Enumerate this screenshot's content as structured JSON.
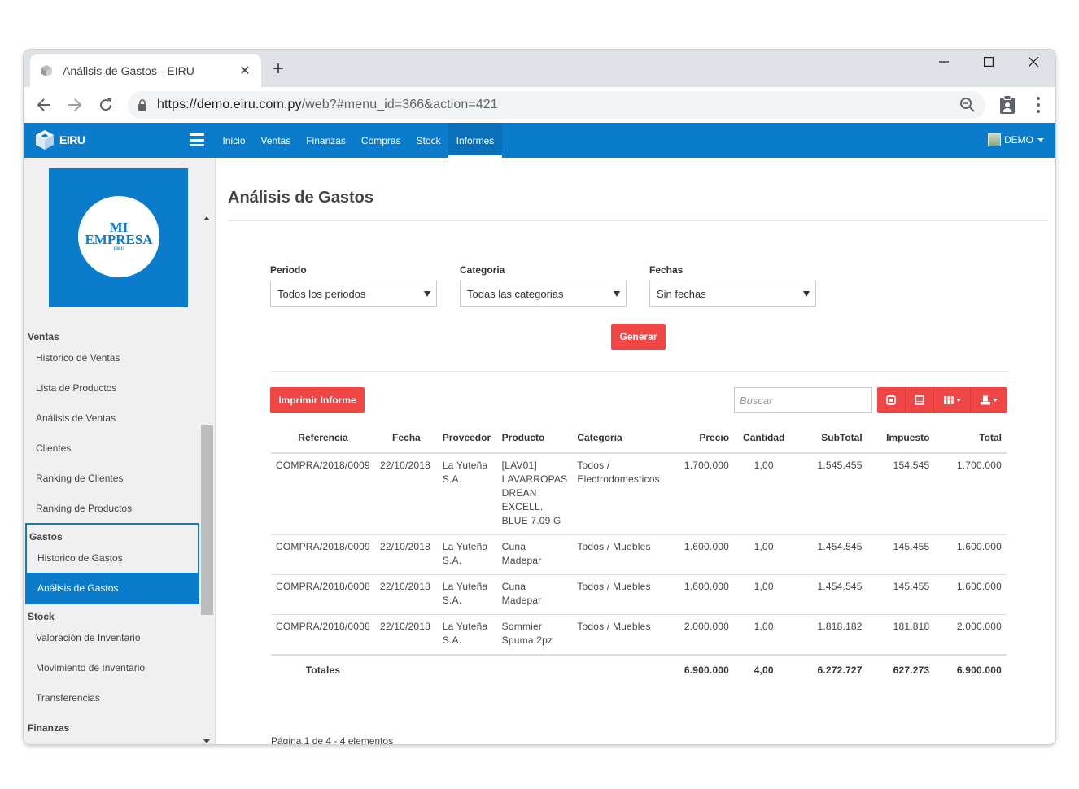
{
  "browser": {
    "tab_title": "Análisis de Gastos - EIRU",
    "url_host": "https://demo.eiru.com.py",
    "url_path": "/web?#menu_id=366&action=421"
  },
  "app": {
    "brand": "EIRU",
    "nav": [
      "Inicio",
      "Ventas",
      "Finanzas",
      "Compras",
      "Stock",
      "Informes"
    ],
    "active_nav": "Informes",
    "user": "DEMO"
  },
  "sidebar": {
    "logo_line1": "MI",
    "logo_line2": "EMPRESA",
    "logo_line3": "EIRU",
    "sections": [
      {
        "title": "Ventas",
        "items": [
          "Historico de Ventas",
          "Lista de Productos",
          "Análisis de Ventas",
          "Clientes",
          "Ranking de Clientes",
          "Ranking de Productos"
        ]
      },
      {
        "title": "Gastos",
        "items": [
          "Historico de Gastos",
          "Análisis de Gastos"
        ]
      },
      {
        "title": "Stock",
        "items": [
          "Valoración de Inventario",
          "Movimiento de Inventario",
          "Transferencias"
        ]
      },
      {
        "title": "Finanzas",
        "items": []
      }
    ],
    "active_item": "Análisis de Gastos"
  },
  "page": {
    "title": "Análisis de Gastos",
    "filters": [
      {
        "label": "Periodo",
        "value": "Todos los periodos"
      },
      {
        "label": "Categoria",
        "value": "Todas las categorias"
      },
      {
        "label": "Fechas",
        "value": "Sin fechas"
      }
    ],
    "generate_label": "Generar",
    "print_label": "Imprimir Informe",
    "search_placeholder": "Buscar"
  },
  "table": {
    "headers": [
      "Referencia",
      "Fecha",
      "Proveedor",
      "Producto",
      "Categoria",
      "Precio",
      "Cantidad",
      "SubTotal",
      "Impuesto",
      "Total"
    ],
    "rows": [
      {
        "ref": "COMPRA/2018/0009",
        "date": "22/10/2018",
        "supplier": "La Yuteña S.A.",
        "product": "[LAV01] LAVARROPAS DREAN EXCELL. BLUE 7.09 G",
        "category": "Todos / Electrodomesticos",
        "price": "1.700.000",
        "qty": "1,00",
        "subtotal": "1.545.455",
        "tax": "154.545",
        "total": "1.700.000"
      },
      {
        "ref": "COMPRA/2018/0009",
        "date": "22/10/2018",
        "supplier": "La Yuteña S.A.",
        "product": "Cuna Madepar",
        "category": "Todos / Muebles",
        "price": "1.600.000",
        "qty": "1,00",
        "subtotal": "1.454.545",
        "tax": "145.455",
        "total": "1.600.000"
      },
      {
        "ref": "COMPRA/2018/0008",
        "date": "22/10/2018",
        "supplier": "La Yuteña S.A.",
        "product": "Cuna Madepar",
        "category": "Todos / Muebles",
        "price": "1.600.000",
        "qty": "1,00",
        "subtotal": "1.454.545",
        "tax": "145.455",
        "total": "1.600.000"
      },
      {
        "ref": "COMPRA/2018/0008",
        "date": "22/10/2018",
        "supplier": "La Yuteña S.A.",
        "product": "Sommier Spuma 2pz",
        "category": "Todos / Muebles",
        "price": "2.000.000",
        "qty": "1,00",
        "subtotal": "1.818.182",
        "tax": "181.818",
        "total": "2.000.000"
      }
    ],
    "totals": {
      "label": "Totales",
      "price": "6.900.000",
      "qty": "4,00",
      "subtotal": "6.272.727",
      "tax": "627.273",
      "total": "6.900.000"
    },
    "pager": "Página 1 de 4 - 4 elementos"
  },
  "colors": {
    "brand": "#0b7bcc",
    "accent_red": "#f04646"
  },
  "icons": [
    "eiru-cube-icon",
    "lock-icon",
    "zoom-icon",
    "clipboard-icon",
    "menu-dots-icon",
    "hamburger-icon",
    "pdf-icon",
    "excel-icon",
    "columns-icon",
    "export-icon"
  ]
}
